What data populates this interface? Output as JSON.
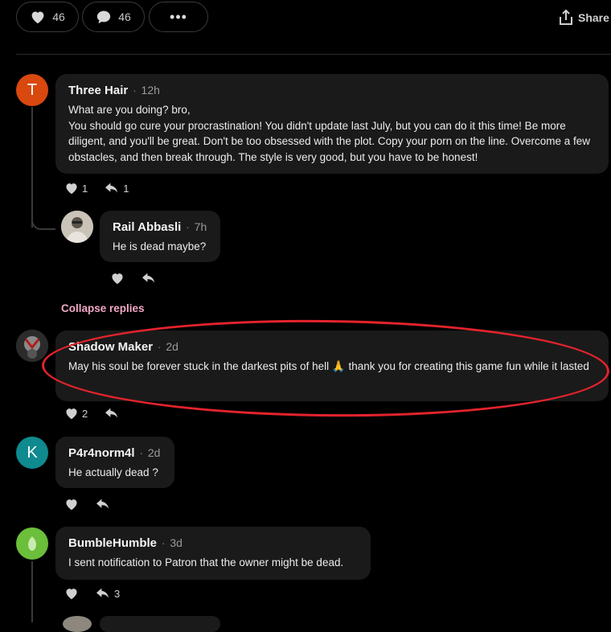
{
  "toolbar": {
    "likes": "46",
    "comments": "46",
    "share_label": "Share"
  },
  "comments": [
    {
      "author": "Three Hair",
      "avatar_letter": "T",
      "avatar_color": "#d9480f",
      "time": "12h",
      "text": "What are you doing? bro,\nYou should go cure your procrastination! You didn't update last July, but you can do it this time! Be more diligent, and you'll be great. Don't be too obsessed with the plot. Copy your porn on the line. Overcome a few obstacles, and then break through. The style is very good, but you have to be honest!",
      "likes": "1",
      "replies": "1"
    },
    {
      "author": "Rail Abbasli",
      "time": "7h",
      "text": "He is dead maybe?"
    },
    {
      "author": "Shadow Maker",
      "time": "2d",
      "text": "May his soul be forever stuck in the darkest pits of hell 🙏 thank you for creating this game fun while it lasted",
      "likes": "2"
    },
    {
      "author": "P4r4norm4l",
      "avatar_letter": "K",
      "avatar_color": "#0f8a8f",
      "time": "2d",
      "text": "He actually dead ?"
    },
    {
      "author": "BumbleHumble",
      "avatar_color": "#6bbf3a",
      "time": "3d",
      "text": "I sent notification to Patron that the owner might be dead.",
      "replies": "3"
    }
  ],
  "collapse_label": "Collapse replies",
  "colors": {
    "annotation": "#e3232c",
    "link": "#f2a7c7"
  }
}
